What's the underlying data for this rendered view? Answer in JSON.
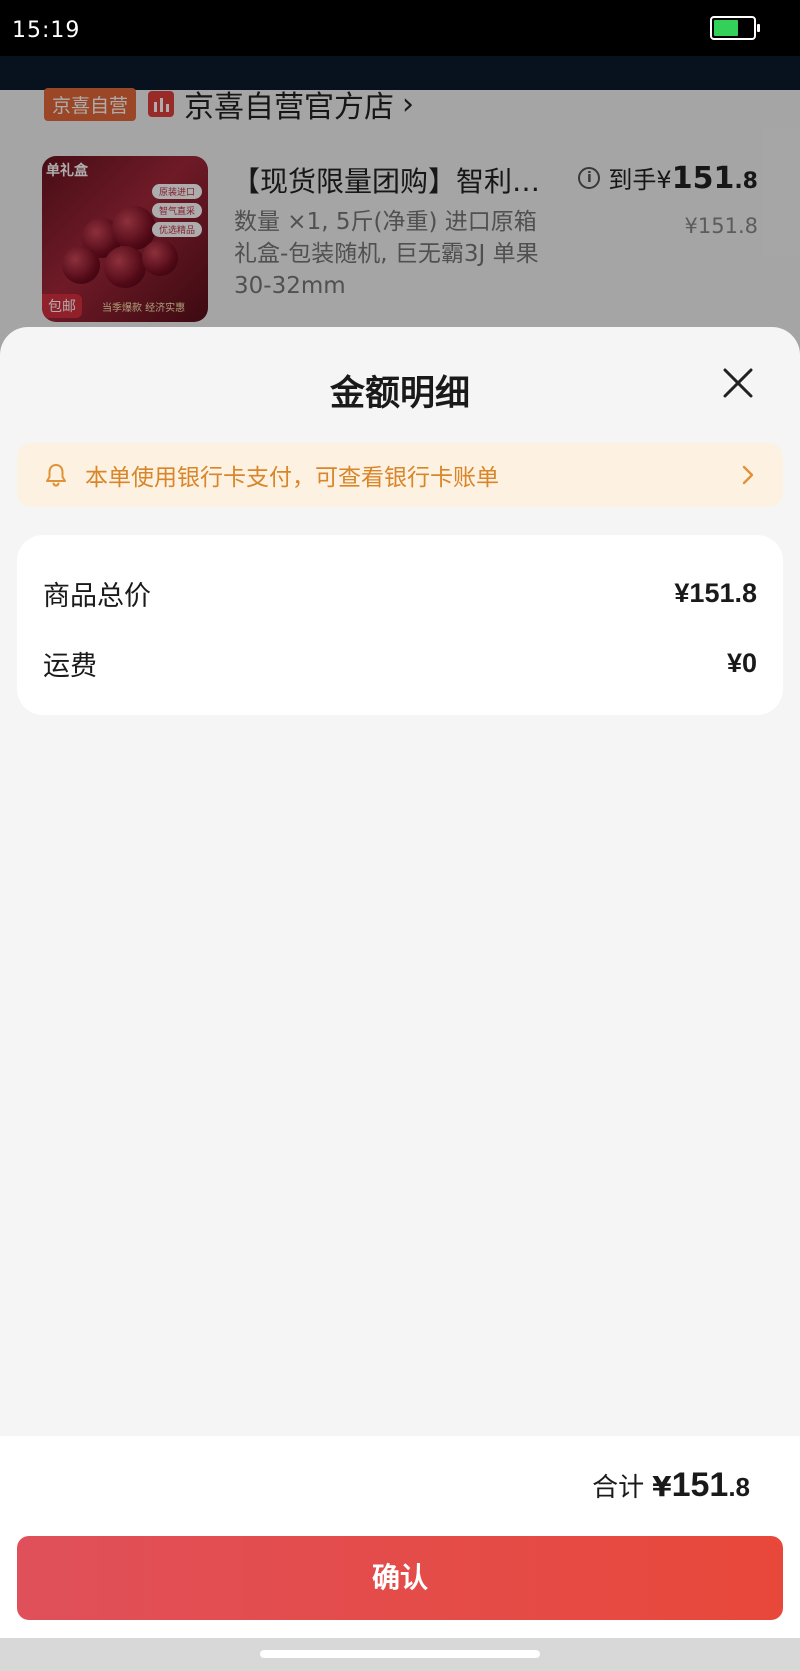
{
  "status_bar": {
    "time": "15:19",
    "battery_level": 0.55,
    "battery_color": "#33d15a"
  },
  "background_order": {
    "store_tag": "京喜自营",
    "store_name": "京喜自营官方店",
    "product": {
      "thumb_label": "单礼盒",
      "thumb_badges": [
        "原装进口",
        "智气直采",
        "优选精品"
      ],
      "thumb_ship": "包邮",
      "thumb_foot": "当季爆款 经济实惠",
      "title": "【现货限量团购】智利…",
      "specs": "数量 ×1, 5斤(净重) 进口原箱礼盒-包装随机, 巨无霸3J 单果30-32mm",
      "price_prefix": "到手¥",
      "price_int": "151",
      "price_dec": ".8",
      "orig_price": "¥151.8"
    }
  },
  "sheet": {
    "title": "金额明细",
    "notice": "本单使用银行卡支付，可查看银行卡账单",
    "fees": [
      {
        "label": "商品总价",
        "value": "¥151.8"
      },
      {
        "label": "运费",
        "value": "¥0"
      }
    ]
  },
  "footer": {
    "total_label": "合计",
    "total_symbol": "¥",
    "total_int": "151",
    "total_dec": ".8",
    "confirm_label": "确认"
  },
  "colors": {
    "accent": "#e44a44",
    "notice_text": "#d9852a",
    "notice_bg": "#fdf2e1"
  }
}
